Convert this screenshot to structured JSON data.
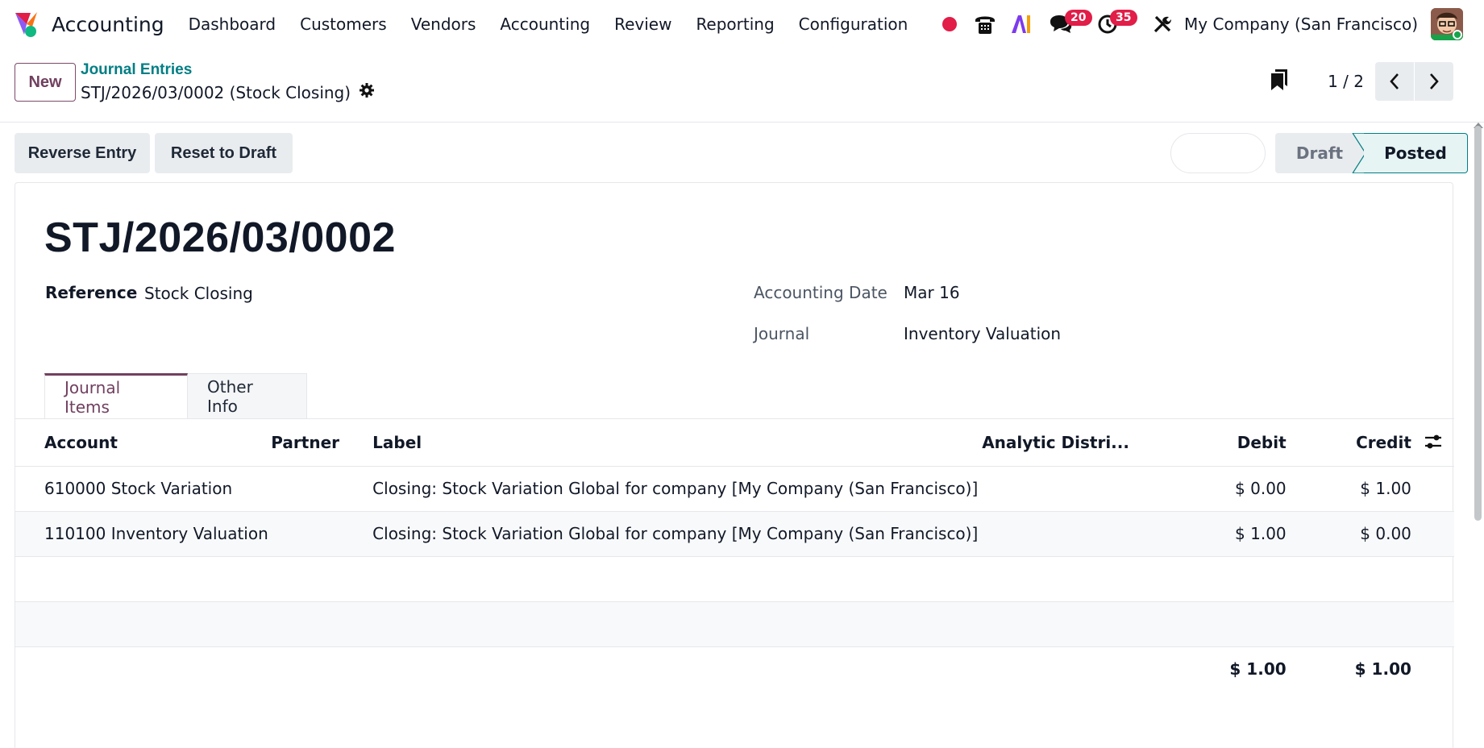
{
  "navbar": {
    "app_name": "Accounting",
    "menu": [
      "Dashboard",
      "Customers",
      "Vendors",
      "Accounting",
      "Review",
      "Reporting",
      "Configuration"
    ],
    "discuss_badge": "20",
    "activity_badge": "35",
    "company": "My Company (San Francisco)",
    "ai_label": "AI"
  },
  "control": {
    "new_label": "New",
    "breadcrumb": "Journal Entries",
    "record_title": "STJ/2026/03/0002 (Stock Closing)",
    "pager": "1 / 2"
  },
  "statusbar": {
    "reverse_label": "Reverse Entry",
    "reset_label": "Reset to Draft",
    "stages": [
      "Draft",
      "Posted"
    ],
    "current_stage": "Posted"
  },
  "form": {
    "name": "STJ/2026/03/0002",
    "reference_label": "Reference",
    "reference_value": "Stock Closing",
    "date_label": "Accounting Date",
    "date_value": "Mar 16",
    "journal_label": "Journal",
    "journal_value": "Inventory Valuation"
  },
  "tabs": [
    "Journal Items",
    "Other Info"
  ],
  "lines": {
    "columns": [
      "Account",
      "Partner",
      "Label",
      "Analytic Distri...",
      "Debit",
      "Credit"
    ],
    "rows": [
      {
        "account": "610000 Stock Variation",
        "partner": "",
        "label": "Closing: Stock Variation Global for company [My Company (San Francisco)]",
        "analytic": "",
        "debit": "$ 0.00",
        "credit": "$ 1.00"
      },
      {
        "account": "110100 Inventory Valuation",
        "partner": "",
        "label": "Closing: Stock Variation Global for company [My Company (San Francisco)]",
        "analytic": "",
        "debit": "$ 1.00",
        "credit": "$ 0.00"
      }
    ],
    "total_debit": "$ 1.00",
    "total_credit": "$ 1.00"
  },
  "colors": {
    "brand": "#71405f",
    "link": "#017e84",
    "badge": "#e11d48",
    "recording_dot": "#e11d48"
  }
}
